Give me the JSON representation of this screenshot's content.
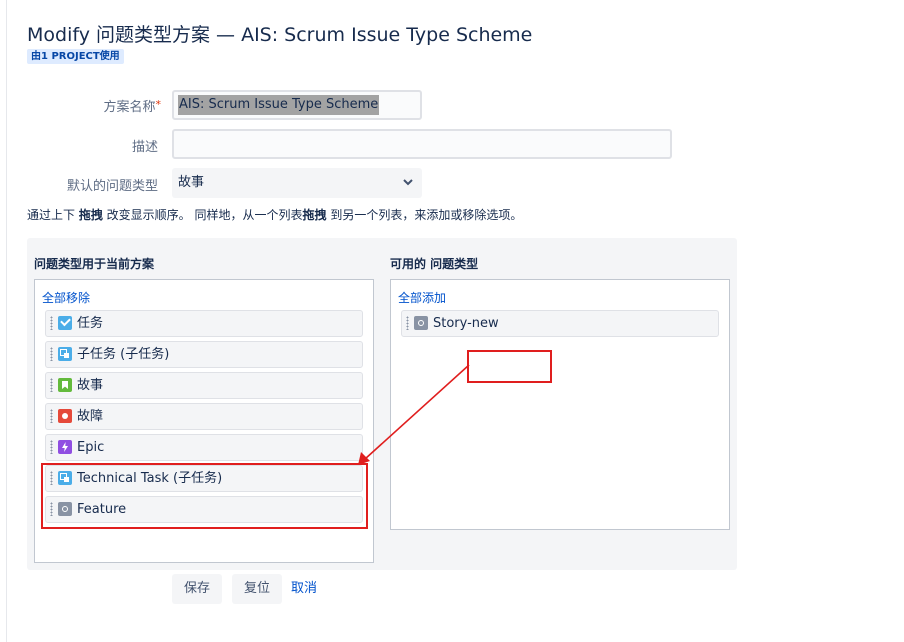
{
  "page": {
    "title": "Modify 问题类型方案 — AIS: Scrum Issue Type Scheme",
    "usage_badge": "由1 PROJECT使用"
  },
  "form": {
    "name_label": "方案名称",
    "name_required_mark": "*",
    "name_value": "AIS: Scrum Issue Type Scheme",
    "description_label": "描述",
    "description_value": "",
    "default_type_label": "默认的问题类型",
    "default_type_value": "故事"
  },
  "instructions": {
    "part1": "通过上下 ",
    "bold1": "拖拽",
    "part2": " 改变显示顺序。 同样地，从一个列表",
    "bold2": "拖拽",
    "part3": " 到另一个列表，来添加或移除选项。"
  },
  "current_list": {
    "title": "问题类型用于当前方案",
    "remove_all": "全部移除",
    "items": [
      {
        "label": "任务",
        "icon": "task-icon"
      },
      {
        "label": "子任务 (子任务)",
        "icon": "subtask-icon"
      },
      {
        "label": "故事",
        "icon": "story-icon"
      },
      {
        "label": "故障",
        "icon": "bug-icon"
      },
      {
        "label": "Epic",
        "icon": "epic-icon"
      },
      {
        "label": "Technical Task (子任务)",
        "icon": "subtask-icon"
      },
      {
        "label": "Feature",
        "icon": "generic-issue-icon"
      }
    ]
  },
  "available_list": {
    "title": "可用的 问题类型",
    "add_all": "全部添加",
    "items": [
      {
        "label": "Story-new",
        "icon": "generic-issue-icon"
      }
    ]
  },
  "buttons": {
    "save": "保存",
    "reset": "复位",
    "cancel": "取消"
  },
  "colors": {
    "annotation": "#e01e1e",
    "link": "#0052cc",
    "panel_bg": "#f4f5f7"
  }
}
